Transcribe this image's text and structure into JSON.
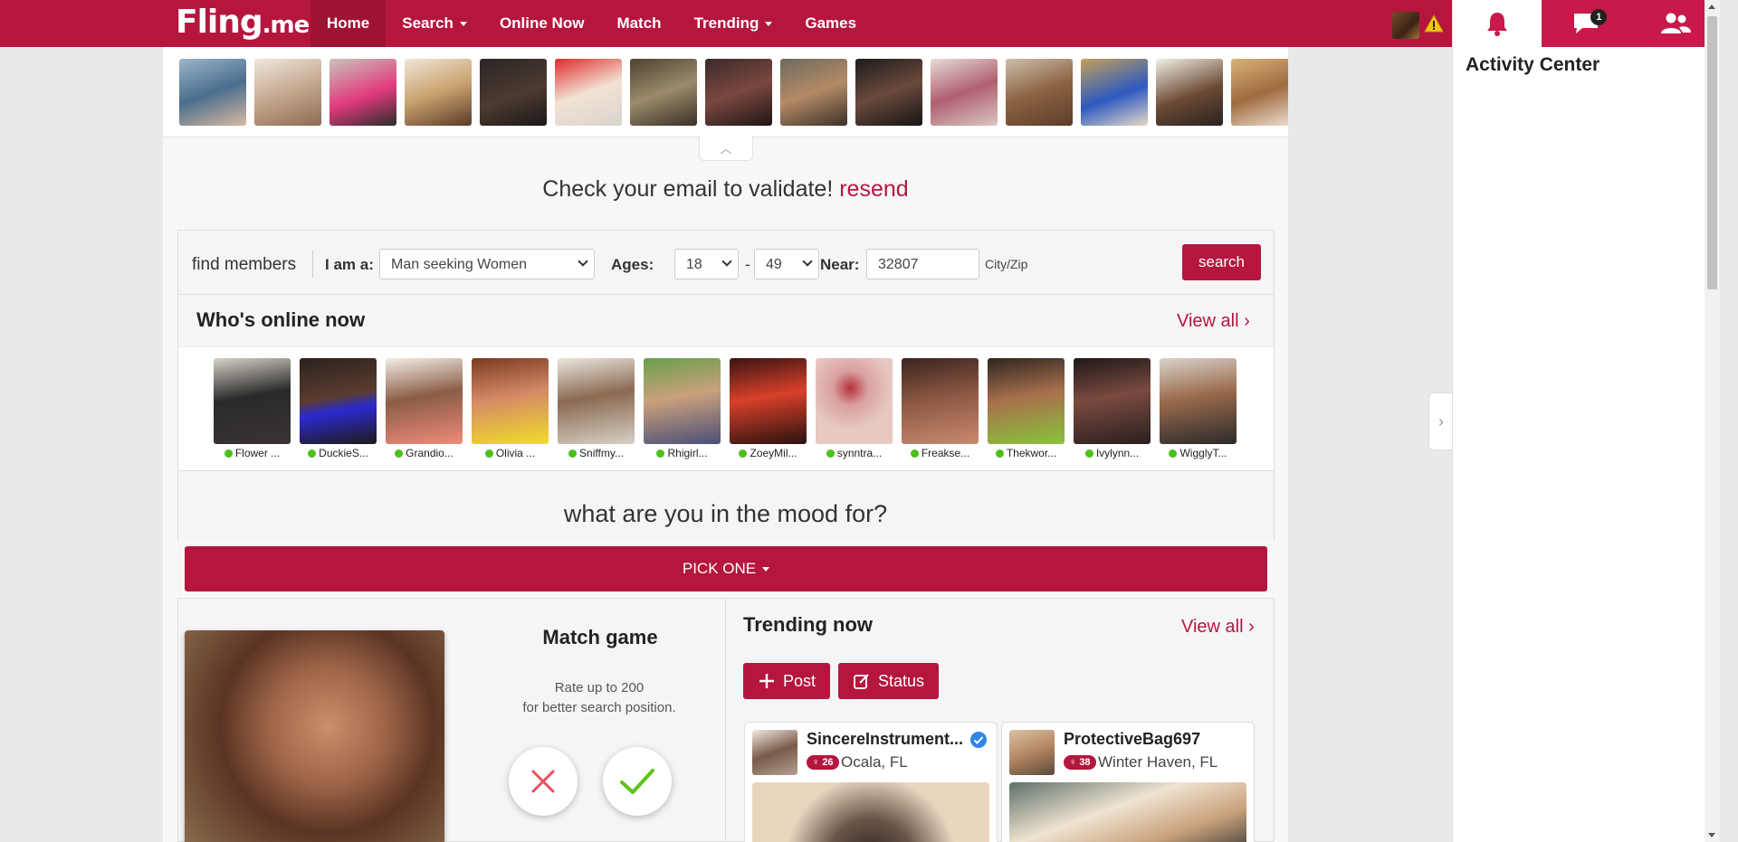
{
  "brand": {
    "logo_main": "Fling",
    "logo_suffix": ".me"
  },
  "nav": {
    "items": [
      {
        "label": "Home"
      },
      {
        "label": "Search"
      },
      {
        "label": "Online Now"
      },
      {
        "label": "Match"
      },
      {
        "label": "Trending"
      },
      {
        "label": "Games"
      }
    ]
  },
  "right_panel": {
    "title": "Activity Center",
    "messages_badge": "1"
  },
  "validate": {
    "text": "Check your email to validate!",
    "link": "resend"
  },
  "search": {
    "find_label": "find members",
    "iam_label": "I am a:",
    "iam_value": "Man seeking Women",
    "ages_label": "Ages:",
    "age_min": "18",
    "age_sep": "-",
    "age_max": "49",
    "near_label": "Near:",
    "near_value": "32807",
    "city_zip": "City/Zip",
    "button": "search"
  },
  "online": {
    "title": "Who's online now",
    "view_all": "View all",
    "members": [
      {
        "name": "Flower ..."
      },
      {
        "name": "DuckieS..."
      },
      {
        "name": "Grandio..."
      },
      {
        "name": "Olivia ..."
      },
      {
        "name": "Sniffmy..."
      },
      {
        "name": "Rhigirl..."
      },
      {
        "name": "ZoeyMil..."
      },
      {
        "name": "synntra..."
      },
      {
        "name": "Freakse..."
      },
      {
        "name": "Thekwor..."
      },
      {
        "name": "Ivylynn..."
      },
      {
        "name": "WigglyT..."
      }
    ]
  },
  "mood": {
    "title": "what are you in the mood for?",
    "pick_one": "PICK ONE"
  },
  "match_game": {
    "title": "Match game",
    "sub_line1": "Rate up to 200",
    "sub_line2": "for better search position."
  },
  "trending": {
    "title": "Trending now",
    "view_all": "View all",
    "post_label": "Post",
    "status_label": "Status",
    "cards": [
      {
        "name": "SincereInstrument...",
        "age": "26",
        "location": "Ocala, FL"
      },
      {
        "name": "ProtectiveBag697",
        "age": "38",
        "location": "Winter Haven, FL"
      }
    ]
  },
  "colors": {
    "brand": "#b5163d",
    "online": "#4cbf1c"
  }
}
